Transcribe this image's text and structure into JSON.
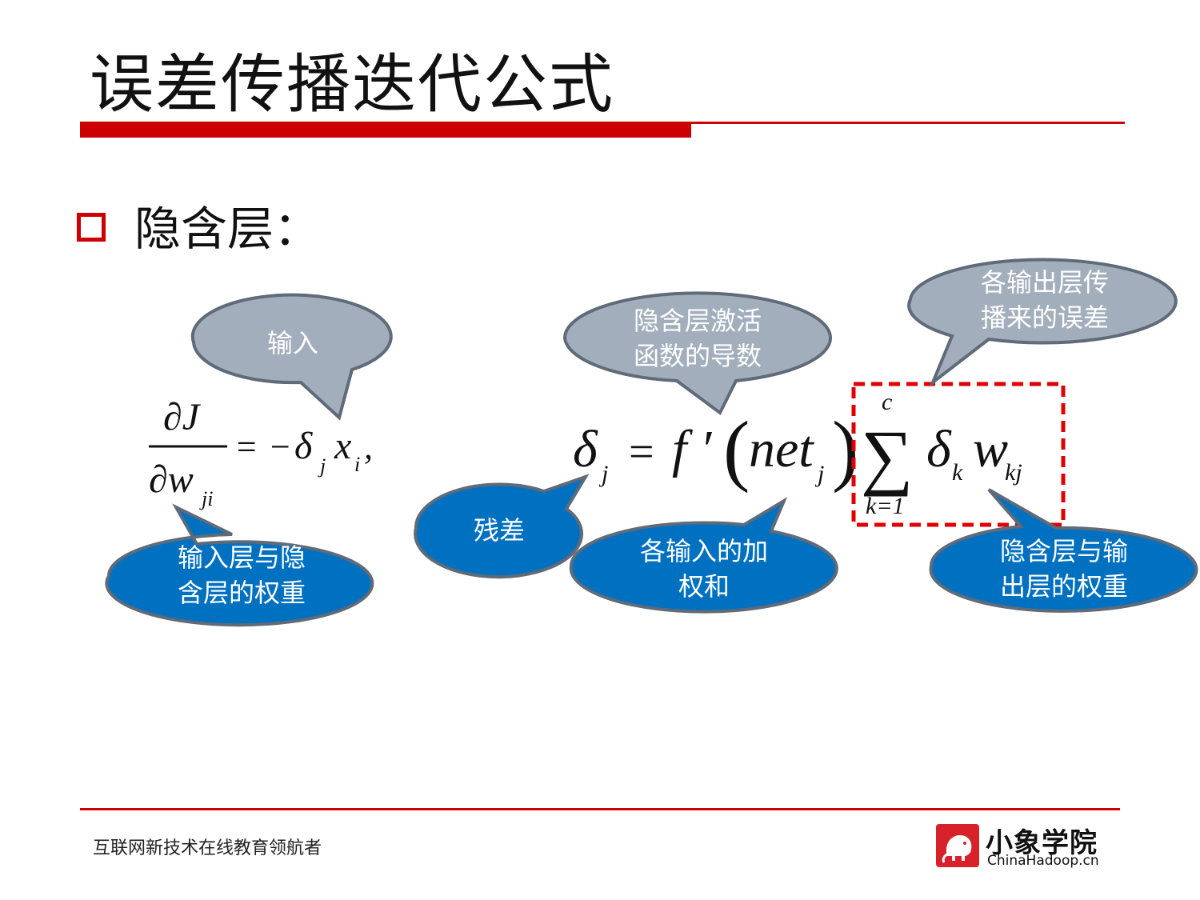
{
  "slide": {
    "title": "误差传播迭代公式",
    "bullet": "隐含层："
  },
  "formula_left": {
    "numerator": "∂J",
    "denominator_base": "∂w",
    "denominator_sub": "ji",
    "equals": "=",
    "rhs_minus": "−",
    "delta": "δ",
    "delta_sub": "j",
    "x": "x",
    "x_sub": "i",
    "comma": ","
  },
  "formula_right": {
    "delta": "δ",
    "delta_sub": "j",
    "equals": "=",
    "f_prime": "f ′",
    "open_paren": "(",
    "net": "net",
    "net_sub": "j",
    "close_paren": ")",
    "sum_symbol": "∑",
    "sum_upper": "c",
    "sum_lower": "k=1",
    "delta_k": "δ",
    "delta_k_sub": "k",
    "w": "w",
    "w_sub": "kj"
  },
  "callouts": {
    "input": "输入",
    "weights_input_hidden_line1": "输入层与隐",
    "weights_input_hidden_line2": "含层的权重",
    "residual": "残差",
    "activation_derivative_line1": "隐含层激活",
    "activation_derivative_line2": "函数的导数",
    "weighted_sum_line1": "各输入的加",
    "weighted_sum_line2": "权和",
    "output_error_line1": "各输出层传",
    "output_error_line2": "播来的误差",
    "weights_hidden_output_line1": "隐含层与输",
    "weights_hidden_output_line2": "出层的权重"
  },
  "colors": {
    "accent_red": "#cc0000",
    "gray_callout": "#a2aebb",
    "blue_callout": "#0070c0",
    "callout_border": "#5f6b78"
  },
  "footer": {
    "slogan": "互联网新技术在线教育领航者",
    "logo_cn": "小象学院",
    "logo_en": "ChinaHadoop.cn"
  }
}
